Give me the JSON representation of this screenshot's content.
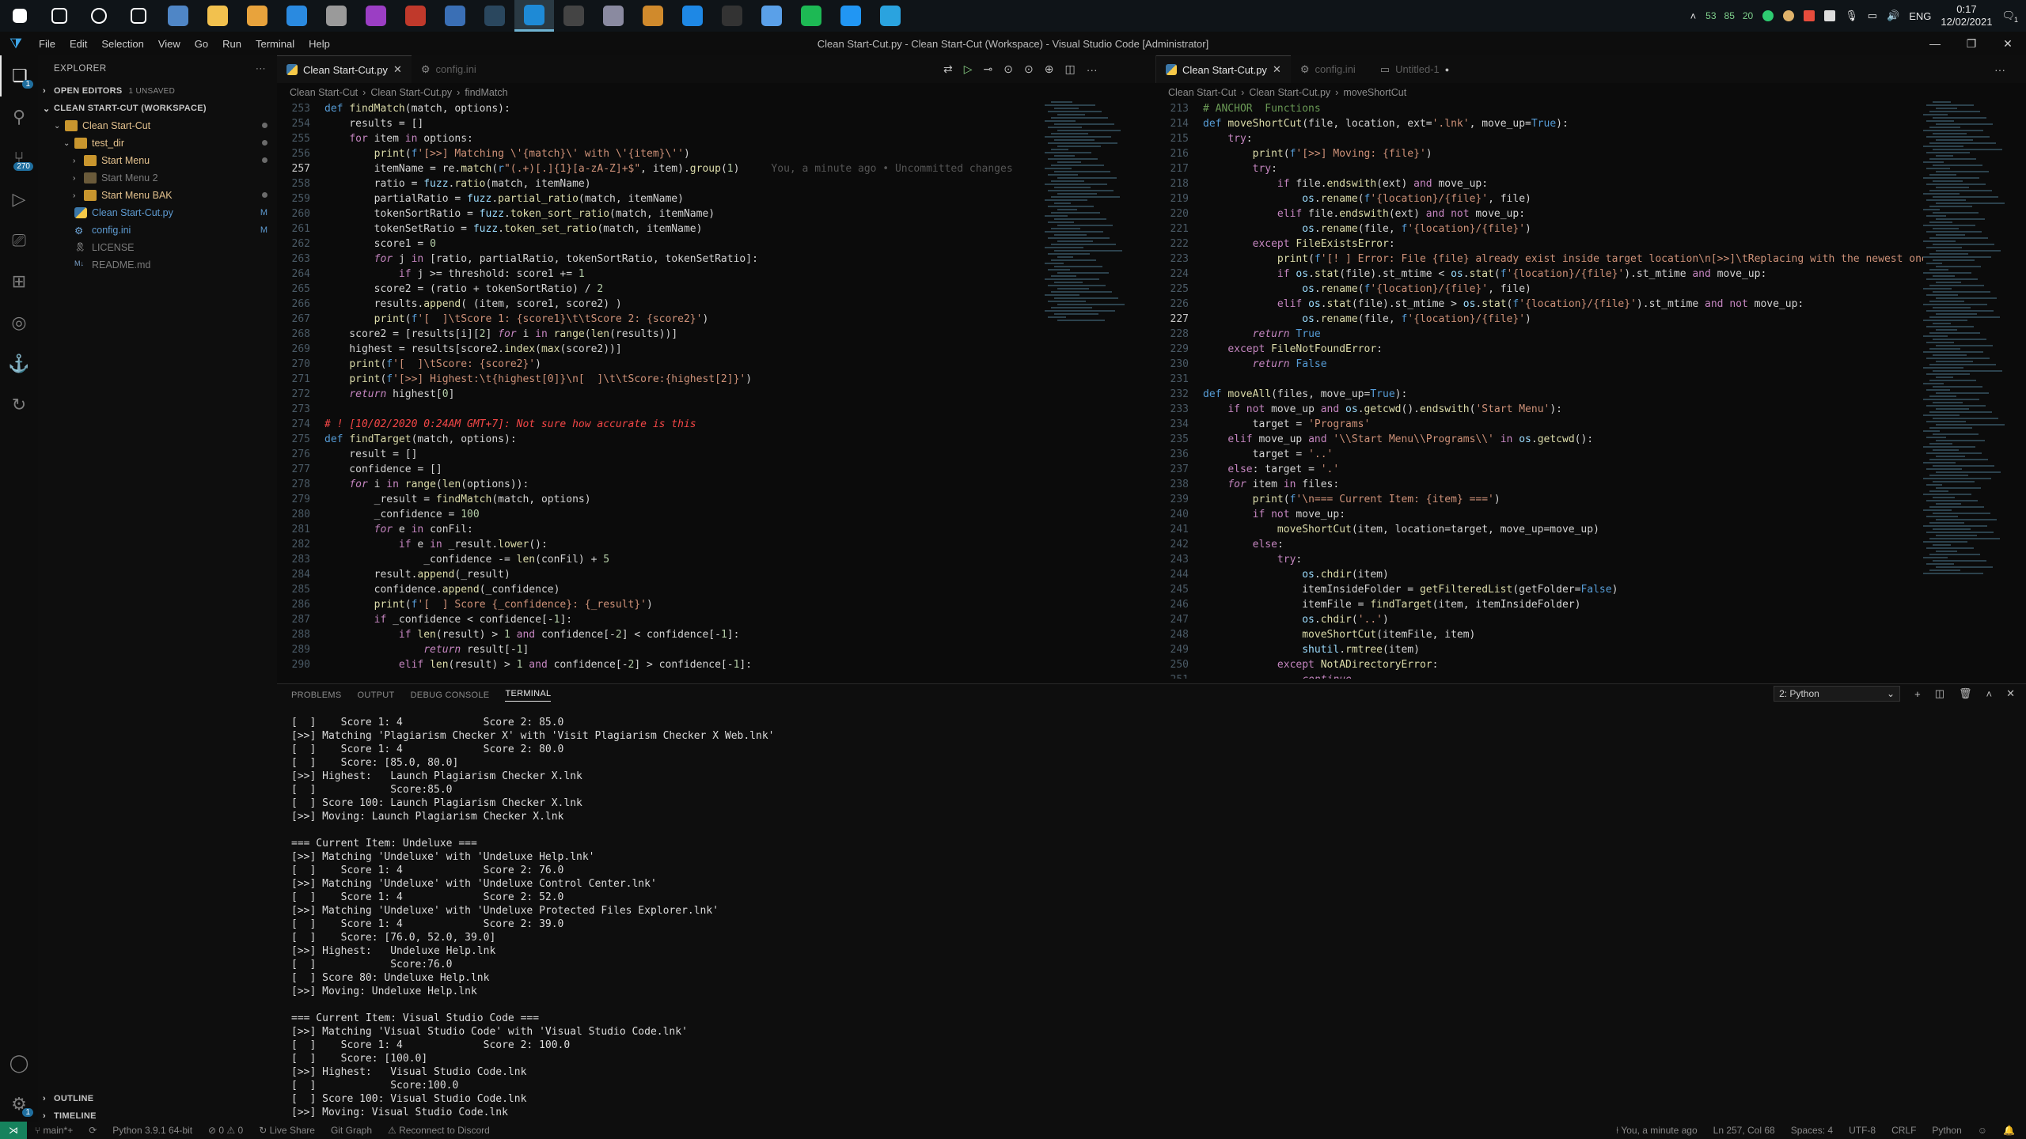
{
  "taskbar": {
    "apps": [
      {
        "name": "start",
        "color": "#ffffff"
      },
      {
        "name": "search",
        "color": "#ffffff"
      },
      {
        "name": "cortana",
        "color": "#ffffff"
      },
      {
        "name": "task-view",
        "color": "#ffffff"
      },
      {
        "name": "app-1",
        "color": "#4f86c6"
      },
      {
        "name": "file-explorer",
        "color": "#f2c14e"
      },
      {
        "name": "folder-2",
        "color": "#e8a33c"
      },
      {
        "name": "app-blue",
        "color": "#2a8ae0"
      },
      {
        "name": "app-3",
        "color": "#9a9a9a"
      },
      {
        "name": "app-4",
        "color": "#9b3ec4"
      },
      {
        "name": "app-red",
        "color": "#c0392b"
      },
      {
        "name": "app-5",
        "color": "#3a6fb5"
      },
      {
        "name": "steam",
        "color": "#2a475e"
      },
      {
        "name": "vscode",
        "color": "#1e8ad6"
      },
      {
        "name": "terminal",
        "color": "#444444"
      },
      {
        "name": "app-6",
        "color": "#8a8aa0"
      },
      {
        "name": "app-7",
        "color": "#d08a2c"
      },
      {
        "name": "app-8",
        "color": "#1e88e5"
      },
      {
        "name": "cmd",
        "color": "#333333"
      },
      {
        "name": "app-9",
        "color": "#5aa0e8"
      },
      {
        "name": "spotify",
        "color": "#1db954"
      },
      {
        "name": "app-10",
        "color": "#2196f3"
      },
      {
        "name": "telegram",
        "color": "#2aa3df"
      }
    ],
    "tray_nums": [
      "53",
      "85",
      "20"
    ],
    "lang": "ENG",
    "time": "0:17",
    "date": "12/02/2021",
    "notif_count": "1"
  },
  "titlebar": {
    "menus": [
      "File",
      "Edit",
      "Selection",
      "View",
      "Go",
      "Run",
      "Terminal",
      "Help"
    ],
    "title": "Clean Start-Cut.py - Clean Start-Cut (Workspace) - Visual Studio Code [Administrator]"
  },
  "activity": {
    "scm_badge": "270",
    "settings_badge": "1"
  },
  "sidebar": {
    "title": "EXPLORER",
    "open_editors": "OPEN EDITORS",
    "open_editors_sub": "1 UNSAVED",
    "workspace": "CLEAN START-CUT (WORKSPACE)",
    "tree": [
      {
        "label": "Clean Start-Cut",
        "indent": 1,
        "type": "folder",
        "open": true,
        "color": "#e2c08d",
        "status": "dot"
      },
      {
        "label": "test_dir",
        "indent": 2,
        "type": "folder",
        "open": true,
        "color": "#e2c08d",
        "status": "dot"
      },
      {
        "label": "Start Menu",
        "indent": 3,
        "type": "folder",
        "open": false,
        "color": "#e2c08d",
        "status": "dot"
      },
      {
        "label": "Start Menu 2",
        "indent": 3,
        "type": "folder",
        "open": false,
        "color": "#7a7a7a",
        "status": ""
      },
      {
        "label": "Start Menu BAK",
        "indent": 3,
        "type": "folder",
        "open": false,
        "color": "#e2c08d",
        "status": "dot"
      },
      {
        "label": "Clean Start-Cut.py",
        "indent": 2,
        "type": "py",
        "open": false,
        "color": "#5e9bd1",
        "status": "M"
      },
      {
        "label": "config.ini",
        "indent": 2,
        "type": "gear",
        "open": false,
        "color": "#5e9bd1",
        "status": "M"
      },
      {
        "label": "LICENSE",
        "indent": 2,
        "type": "license",
        "open": false,
        "color": "#7a7a7a",
        "status": ""
      },
      {
        "label": "README.md",
        "indent": 2,
        "type": "md",
        "open": false,
        "color": "#7a7a7a",
        "status": ""
      }
    ],
    "outline": "OUTLINE",
    "timeline": "TIMELINE"
  },
  "left_editor": {
    "tabs": [
      {
        "label": "Clean Start-Cut.py",
        "active": true
      },
      {
        "label": "config.ini",
        "active": false
      }
    ],
    "breadcrumb": [
      "Clean Start-Cut",
      "Clean Start-Cut.py",
      "findMatch"
    ],
    "lines": [
      {
        "n": "253",
        "html": "<span class='kb'>def</span> <span class='f'>findMatch</span>(match, options):"
      },
      {
        "n": "254",
        "html": "    results = []"
      },
      {
        "n": "255",
        "html": "    <span class='k'>for</span> item <span class='k'>in</span> options:"
      },
      {
        "n": "256",
        "html": "        <span class='f'>print</span>(<span class='kb'>f</span><span class='s'>'[&gt;&gt;] Matching \\'{match}\\' with \\'{item}\\''</span>)"
      },
      {
        "n": "257",
        "html": "        itemName = re.<span class='f'>match</span>(<span class='kb'>r</span><span class='s'>\"(.+)[.]{1}[a-zA-Z]+$\"</span>, item).<span class='f'>group</span>(<span class='n'>1</span>)<span class='ghost'>You, a minute ago • Uncommitted changes</span>",
        "cur": true
      },
      {
        "n": "258",
        "html": "        ratio = <span class='v'>fuzz</span>.<span class='f'>ratio</span>(match, itemName)"
      },
      {
        "n": "259",
        "html": "        partialRatio = <span class='v'>fuzz</span>.<span class='f'>partial_ratio</span>(match, itemName)"
      },
      {
        "n": "260",
        "html": "        tokenSortRatio = <span class='v'>fuzz</span>.<span class='f'>token_sort_ratio</span>(match, itemName)"
      },
      {
        "n": "261",
        "html": "        tokenSetRatio = <span class='v'>fuzz</span>.<span class='f'>token_set_ratio</span>(match, itemName)"
      },
      {
        "n": "262",
        "html": "        score1 = <span class='n'>0</span>"
      },
      {
        "n": "263",
        "html": "        <span class='kw'>for</span> j <span class='k'>in</span> [ratio, partialRatio, tokenSortRatio, tokenSetRatio]:"
      },
      {
        "n": "264",
        "html": "            <span class='k'>if</span> j &gt;= threshold: score1 += <span class='n'>1</span>"
      },
      {
        "n": "265",
        "html": "        score2 = (ratio + tokenSortRatio) / <span class='n'>2</span>"
      },
      {
        "n": "266",
        "html": "        results.<span class='f'>append</span>( (item, score1, score2) )"
      },
      {
        "n": "267",
        "html": "        <span class='f'>print</span>(<span class='kb'>f</span><span class='s'>'[  ]\\tScore 1: {score1}\\t\\tScore 2: {score2}'</span>)"
      },
      {
        "n": "268",
        "html": "    score2 = [results[i][<span class='n'>2</span>] <span class='kw'>for</span> i <span class='k'>in</span> <span class='f'>range</span>(<span class='f'>len</span>(results))]"
      },
      {
        "n": "269",
        "html": "    highest = results[score2.<span class='f'>index</span>(<span class='f'>max</span>(score2))]"
      },
      {
        "n": "270",
        "html": "    <span class='f'>print</span>(<span class='kb'>f</span><span class='s'>'[  ]\\tScore: {score2}'</span>)"
      },
      {
        "n": "271",
        "html": "    <span class='f'>print</span>(<span class='kb'>f</span><span class='s'>'[&gt;&gt;] Highest:\\t{highest[0]}\\n[  ]\\t\\tScore:{highest[2]}'</span>)"
      },
      {
        "n": "272",
        "html": "    <span class='kw'>return</span> highest[<span class='n'>0</span>]"
      },
      {
        "n": "273",
        "html": ""
      },
      {
        "n": "274",
        "html": "<span class='cr'># ! [10/02/2020 0:24AM GMT+7]: Not sure how accurate is this</span>"
      },
      {
        "n": "275",
        "html": "<span class='kb'>def</span> <span class='f'>findTarget</span>(match, options):"
      },
      {
        "n": "276",
        "html": "    result = []"
      },
      {
        "n": "277",
        "html": "    confidence = []"
      },
      {
        "n": "278",
        "html": "    <span class='kw'>for</span> i <span class='k'>in</span> <span class='f'>range</span>(<span class='f'>len</span>(options)):"
      },
      {
        "n": "279",
        "html": "        _result = <span class='f'>findMatch</span>(match, options)"
      },
      {
        "n": "280",
        "html": "        _confidence = <span class='n'>100</span>"
      },
      {
        "n": "281",
        "html": "        <span class='kw'>for</span> e <span class='k'>in</span> conFil:"
      },
      {
        "n": "282",
        "html": "            <span class='k'>if</span> e <span class='k'>in</span> _result.<span class='f'>lower</span>():"
      },
      {
        "n": "283",
        "html": "                _confidence -= <span class='f'>len</span>(conFil) + <span class='n'>5</span>"
      },
      {
        "n": "284",
        "html": "        result.<span class='f'>append</span>(_result)"
      },
      {
        "n": "285",
        "html": "        confidence.<span class='f'>append</span>(_confidence)"
      },
      {
        "n": "286",
        "html": "        <span class='f'>print</span>(<span class='kb'>f</span><span class='s'>'[  ] Score {_confidence}: {_result}'</span>)"
      },
      {
        "n": "287",
        "html": "        <span class='k'>if</span> _confidence &lt; confidence[-<span class='n'>1</span>]:"
      },
      {
        "n": "288",
        "html": "            <span class='k'>if</span> <span class='f'>len</span>(result) &gt; <span class='n'>1</span> <span class='k'>and</span> confidence[-<span class='n'>2</span>] &lt; confidence[-<span class='n'>1</span>]:"
      },
      {
        "n": "289",
        "html": "                <span class='kw'>return</span> result[-<span class='n'>1</span>]"
      },
      {
        "n": "290",
        "html": "            <span class='k'>elif</span> <span class='f'>len</span>(result) &gt; <span class='n'>1</span> <span class='k'>and</span> confidence[-<span class='n'>2</span>] &gt; confidence[-<span class='n'>1</span>]:"
      }
    ]
  },
  "right_editor": {
    "tabs": [
      {
        "label": "Clean Start-Cut.py",
        "active": true
      },
      {
        "label": "config.ini",
        "active": false
      },
      {
        "label": "Untitled-1",
        "active": false
      }
    ],
    "breadcrumb": [
      "Clean Start-Cut",
      "Clean Start-Cut.py",
      "moveShortCut"
    ],
    "lines": [
      {
        "n": "213",
        "html": "<span class='c'># ANCHOR  Functions</span>"
      },
      {
        "n": "214",
        "html": "<span class='kb'>def</span> <span class='f'>moveShortCut</span>(file, location, ext=<span class='s'>'.lnk'</span>, move_up=<span class='kb'>True</span>):"
      },
      {
        "n": "215",
        "html": "    <span class='k'>try</span>:"
      },
      {
        "n": "216",
        "html": "        <span class='f'>print</span>(<span class='kb'>f</span><span class='s'>'[&gt;&gt;] Moving: {file}'</span>)"
      },
      {
        "n": "217",
        "html": "        <span class='k'>try</span>:"
      },
      {
        "n": "218",
        "html": "            <span class='k'>if</span> file.<span class='f'>endswith</span>(ext) <span class='k'>and</span> move_up:"
      },
      {
        "n": "219",
        "html": "                <span class='v'>os</span>.<span class='f'>rename</span>(<span class='kb'>f</span><span class='s'>'{location}/{file}'</span>, file)"
      },
      {
        "n": "220",
        "html": "            <span class='k'>elif</span> file.<span class='f'>endswith</span>(ext) <span class='k'>and not</span> move_up:"
      },
      {
        "n": "221",
        "html": "                <span class='v'>os</span>.<span class='f'>rename</span>(file, <span class='kb'>f</span><span class='s'>'{location}/{file}'</span>)"
      },
      {
        "n": "222",
        "html": "        <span class='k'>except</span> <span class='f'>FileExistsError</span>:"
      },
      {
        "n": "223",
        "html": "            <span class='f'>print</span>(<span class='kb'>f</span><span class='s'>'[! ] Error: File {file} already exist inside target location\\n[&gt;&gt;]\\tReplacing with the newest one</span>"
      },
      {
        "n": "224",
        "html": "            <span class='k'>if</span> <span class='v'>os</span>.<span class='f'>stat</span>(file).st_mtime &lt; <span class='v'>os</span>.<span class='f'>stat</span>(<span class='kb'>f</span><span class='s'>'{location}/{file}'</span>).st_mtime <span class='k'>and</span> move_up:"
      },
      {
        "n": "225",
        "html": "                <span class='v'>os</span>.<span class='f'>rename</span>(<span class='kb'>f</span><span class='s'>'{location}/{file}'</span>, file)"
      },
      {
        "n": "226",
        "html": "            <span class='k'>elif</span> <span class='v'>os</span>.<span class='f'>stat</span>(file).st_mtime &gt; <span class='v'>os</span>.<span class='f'>stat</span>(<span class='kb'>f</span><span class='s'>'{location}/{file}'</span>).st_mtime <span class='k'>and not</span> move_up:"
      },
      {
        "n": "227",
        "html": "                <span class='v'>os</span>.<span class='f'>rename</span>(file, <span class='kb'>f</span><span class='s'>'{location}/{file}'</span>)",
        "cur": true
      },
      {
        "n": "228",
        "html": "        <span class='kw'>return</span> <span class='kb'>True</span>"
      },
      {
        "n": "229",
        "html": "    <span class='k'>except</span> <span class='f'>FileNotFoundError</span>:"
      },
      {
        "n": "230",
        "html": "        <span class='kw'>return</span> <span class='kb'>False</span>"
      },
      {
        "n": "231",
        "html": ""
      },
      {
        "n": "232",
        "html": "<span class='kb'>def</span> <span class='f'>moveAll</span>(files, move_up=<span class='kb'>True</span>):"
      },
      {
        "n": "233",
        "html": "    <span class='k'>if not</span> move_up <span class='k'>and</span> <span class='v'>os</span>.<span class='f'>getcwd</span>().<span class='f'>endswith</span>(<span class='s'>'Start Menu'</span>):"
      },
      {
        "n": "234",
        "html": "        target = <span class='s'>'Programs'</span>"
      },
      {
        "n": "235",
        "html": "    <span class='k'>elif</span> move_up <span class='k'>and</span> <span class='s'>'\\\\Start Menu\\\\Programs\\\\'</span> <span class='k'>in</span> <span class='v'>os</span>.<span class='f'>getcwd</span>():"
      },
      {
        "n": "236",
        "html": "        target = <span class='s'>'..'</span>"
      },
      {
        "n": "237",
        "html": "    <span class='k'>else</span>: target = <span class='s'>'.'</span>"
      },
      {
        "n": "238",
        "html": "    <span class='kw'>for</span> item <span class='k'>in</span> files:"
      },
      {
        "n": "239",
        "html": "        <span class='f'>print</span>(<span class='kb'>f</span><span class='s'>'\\n=== Current Item: {item} ==='</span>)"
      },
      {
        "n": "240",
        "html": "        <span class='k'>if not</span> move_up:"
      },
      {
        "n": "241",
        "html": "            <span class='f'>moveShortCut</span>(item, location=target, move_up=move_up)"
      },
      {
        "n": "242",
        "html": "        <span class='k'>else</span>:"
      },
      {
        "n": "243",
        "html": "            <span class='k'>try</span>:"
      },
      {
        "n": "244",
        "html": "                <span class='v'>os</span>.<span class='f'>chdir</span>(item)"
      },
      {
        "n": "245",
        "html": "                itemInsideFolder = <span class='f'>getFilteredList</span>(getFolder=<span class='kb'>False</span>)"
      },
      {
        "n": "246",
        "html": "                itemFile = <span class='f'>findTarget</span>(item, itemInsideFolder)"
      },
      {
        "n": "247",
        "html": "                <span class='v'>os</span>.<span class='f'>chdir</span>(<span class='s'>'..'</span>)"
      },
      {
        "n": "248",
        "html": "                <span class='f'>moveShortCut</span>(itemFile, item)"
      },
      {
        "n": "249",
        "html": "                <span class='v'>shutil</span>.<span class='f'>rmtree</span>(item)"
      },
      {
        "n": "250",
        "html": "            <span class='k'>except</span> <span class='f'>NotADirectoryError</span>:"
      },
      {
        "n": "251",
        "html": "                <span class='kw'>continue</span>"
      }
    ]
  },
  "panel": {
    "tabs": [
      "PROBLEMS",
      "OUTPUT",
      "DEBUG CONSOLE",
      "TERMINAL"
    ],
    "active_tab": "TERMINAL",
    "terminal_select": "2: Python",
    "terminal": [
      "[  ]    Score 1: 4             Score 2: 85.0",
      "[>>] Matching 'Plagiarism Checker X' with 'Visit Plagiarism Checker X Web.lnk'",
      "[  ]    Score 1: 4             Score 2: 80.0",
      "[  ]    Score: [85.0, 80.0]",
      "[>>] Highest:   Launch Plagiarism Checker X.lnk",
      "[  ]            Score:85.0",
      "[  ] Score 100: Launch Plagiarism Checker X.lnk",
      "[>>] Moving: Launch Plagiarism Checker X.lnk",
      "",
      "=== Current Item: Undeluxe ===",
      "[>>] Matching 'Undeluxe' with 'Undeluxe Help.lnk'",
      "[  ]    Score 1: 4             Score 2: 76.0",
      "[>>] Matching 'Undeluxe' with 'Undeluxe Control Center.lnk'",
      "[  ]    Score 1: 4             Score 2: 52.0",
      "[>>] Matching 'Undeluxe' with 'Undeluxe Protected Files Explorer.lnk'",
      "[  ]    Score 1: 4             Score 2: 39.0",
      "[  ]    Score: [76.0, 52.0, 39.0]",
      "[>>] Highest:   Undeluxe Help.lnk",
      "[  ]            Score:76.0",
      "[  ] Score 80: Undeluxe Help.lnk",
      "[>>] Moving: Undeluxe Help.lnk",
      "",
      "=== Current Item: Visual Studio Code ===",
      "[>>] Matching 'Visual Studio Code' with 'Visual Studio Code.lnk'",
      "[  ]    Score 1: 4             Score 2: 100.0",
      "[  ]    Score: [100.0]",
      "[>>] Highest:   Visual Studio Code.lnk",
      "[  ]            Score:100.0",
      "[  ] Score 100: Visual Studio Code.lnk",
      "[>>] Moving: Visual Studio Code.lnk"
    ]
  },
  "statusbar": {
    "branch": "main*+",
    "python": "Python 3.9.1 64-bit",
    "problems": "⊘ 0 ⚠ 0",
    "liveshare": "Live Share",
    "gitgraph": "Git Graph",
    "discord": "Reconnect to Discord",
    "blame": "You, a minute ago",
    "position": "Ln 257, Col 68",
    "spaces": "Spaces: 4",
    "encoding": "UTF-8",
    "eol": "CRLF",
    "language": "Python"
  }
}
